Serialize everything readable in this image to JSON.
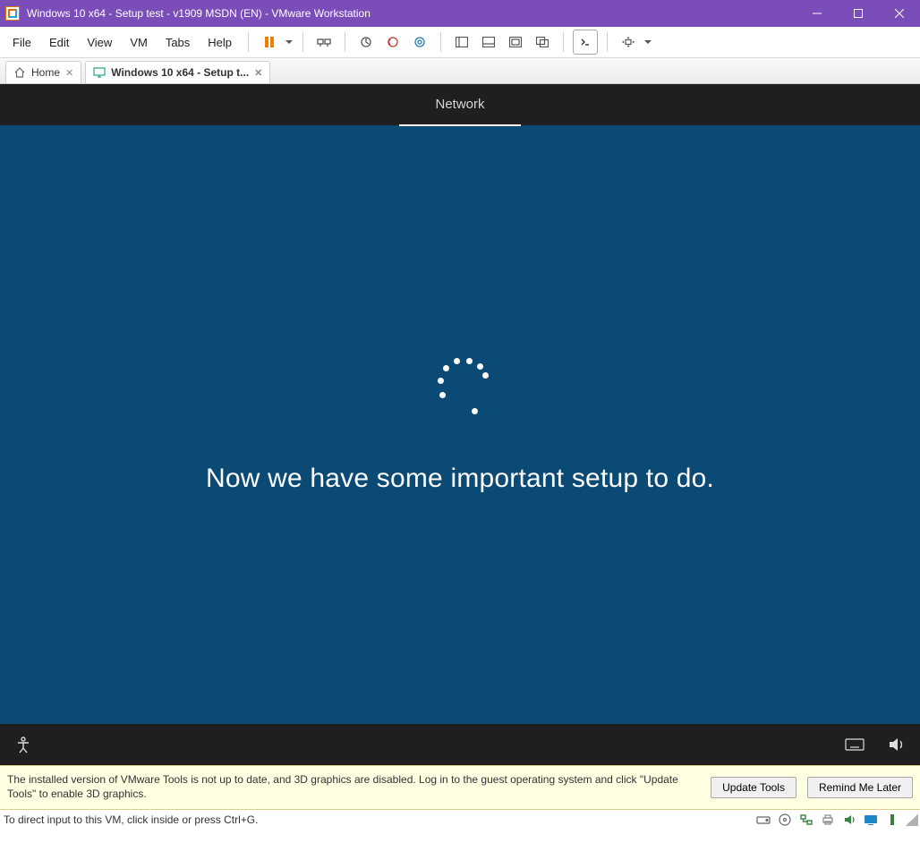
{
  "window": {
    "title": "Windows 10 x64 - Setup test - v1909 MSDN (EN) - VMware Workstation"
  },
  "menu": {
    "file": "File",
    "edit": "Edit",
    "view": "View",
    "vm": "VM",
    "tabs": "Tabs",
    "help": "Help"
  },
  "tabs": {
    "home": "Home",
    "active": "Windows 10 x64 - Setup t..."
  },
  "oobe": {
    "step": "Network",
    "message": "Now we have some important setup to do."
  },
  "infobar": {
    "message": "The installed version of VMware Tools is not up to date, and 3D graphics are disabled. Log in to the guest operating system and click \"Update Tools\" to enable 3D graphics.",
    "update_label": "Update Tools",
    "remind_label": "Remind Me Later"
  },
  "statusbar": {
    "hint": "To direct input to this VM, click inside or press Ctrl+G."
  },
  "colors": {
    "titlebar": "#7a4db9",
    "oobe_bg": "#0b4a75",
    "pause": "#f57c00"
  }
}
